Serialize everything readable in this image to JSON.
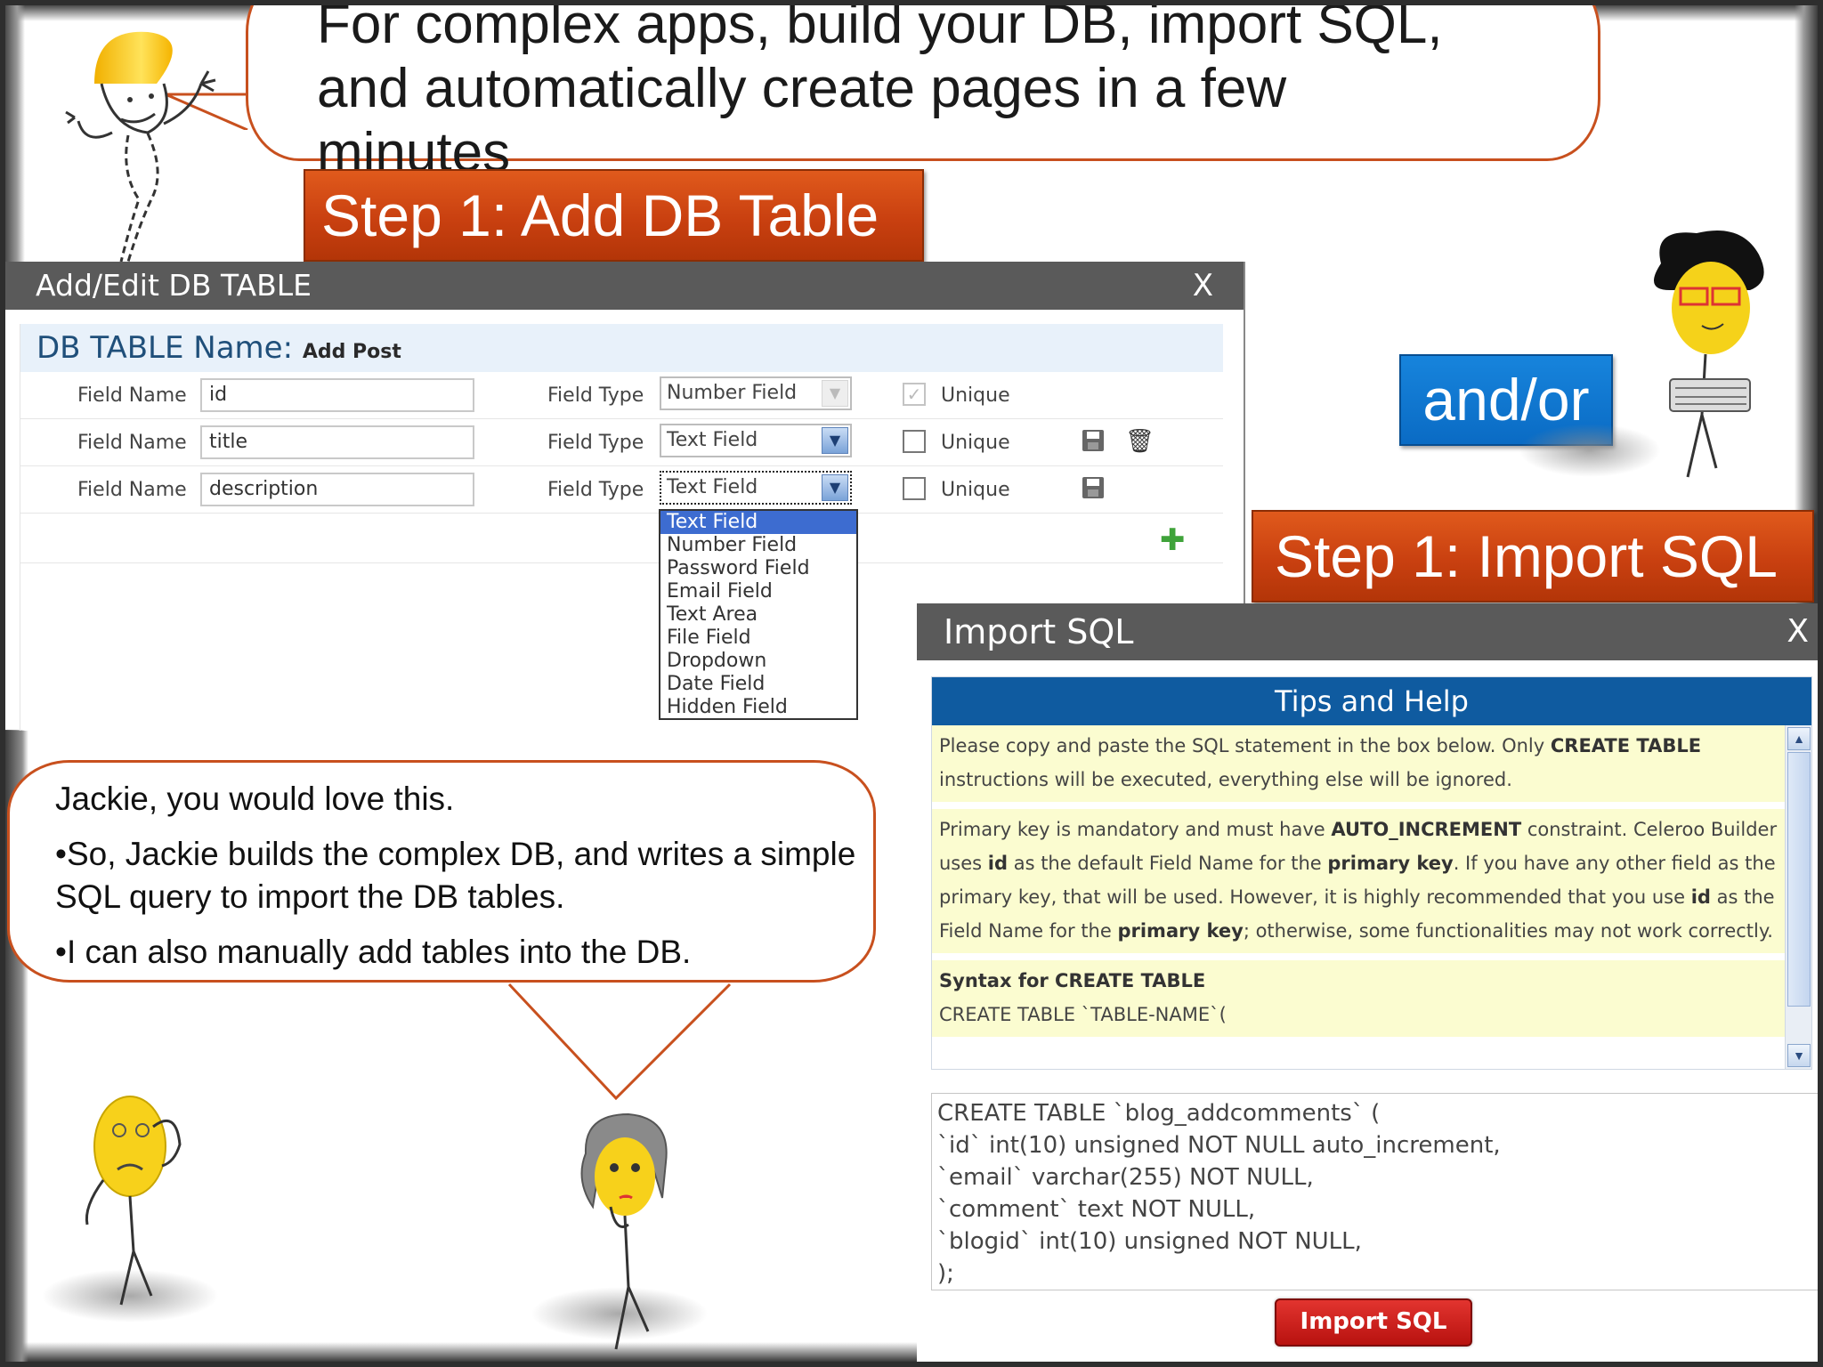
{
  "headline": {
    "text": "For complex apps, build your DB, import SQL, and automatically create pages in a few minutes"
  },
  "banners": {
    "add_table": "Step 1: Add DB Table",
    "import_sql": "Step 1: Import SQL",
    "andor": "and/or"
  },
  "add_edit_dialog": {
    "title": "Add/Edit DB TABLE",
    "close": "X",
    "table_name_label": "DB TABLE Name:",
    "table_name_value": "Add Post",
    "field_name_label": "Field Name",
    "field_type_label": "Field Type",
    "unique_label": "Unique",
    "rows": [
      {
        "field_name": "id",
        "field_type": "Number Field",
        "unique_checked": true
      },
      {
        "field_name": "title",
        "field_type": "Text Field",
        "unique_checked": false
      },
      {
        "field_name": "description",
        "field_type": "Text Field",
        "unique_checked": false
      }
    ],
    "dropdown_options": [
      "Text Field",
      "Number Field",
      "Password Field",
      "Email Field",
      "Text Area",
      "File Field",
      "Dropdown",
      "Date Field",
      "Hidden Field"
    ],
    "dropdown_selected": "Text Field"
  },
  "dialogue": {
    "lines": [
      "Jackie, you would love this.",
      "•So, Jackie builds the complex DB, and writes a simple SQL query to import the DB tables.",
      "•I can also manually add tables into the DB."
    ]
  },
  "import_dialog": {
    "title": "Import SQL",
    "close": "X",
    "tips_title": "Tips and Help",
    "tip1_a": "Please copy and paste the SQL statement in the box below. Only ",
    "tip1_b": "CREATE TABLE",
    "tip1_c": " instructions will be executed, everything else will be ignored.",
    "tip2_a": "Primary key is mandatory and must have ",
    "tip2_b": "AUTO_INCREMENT",
    "tip2_c": " constraint. Celeroo Builder uses ",
    "tip2_d": "id",
    "tip2_e": " as the default Field Name for the ",
    "tip2_f": "primary key",
    "tip2_g": ". If you have any other field as the primary key, that will be used. However, it is highly recommended that you use ",
    "tip2_h": "id",
    "tip2_i": " as the Field Name for the ",
    "tip2_j": "primary key",
    "tip2_k": "; otherwise, some functionalities may not work correctly.",
    "syntax_title": "Syntax for CREATE TABLE",
    "syntax_line": "CREATE TABLE `TABLE-NAME`(",
    "sql_text": "CREATE TABLE `blog_addcomments` (\n`id` int(10) unsigned NOT NULL auto_increment,\n`email` varchar(255) NOT NULL,\n`comment` text NOT NULL,\n`blogid` int(10) unsigned NOT NULL,\n);",
    "import_button": "Import SQL"
  },
  "icons": {
    "save": "floppy-disk-icon",
    "delete": "trash-icon",
    "add": "plus-icon",
    "dropdown": "chevron-down-icon",
    "scroll_up": "arrow-up-icon",
    "scroll_down": "arrow-down-icon"
  },
  "colors": {
    "banner_orange": "#c94010",
    "andor_blue": "#0a6bc4",
    "dialog_title_gray": "#5a5a5a",
    "tips_header_blue": "#0f5ba0",
    "tips_bg_yellow": "#fbfcd0",
    "import_button_red": "#c21a16",
    "bubble_border": "#c8501e"
  }
}
